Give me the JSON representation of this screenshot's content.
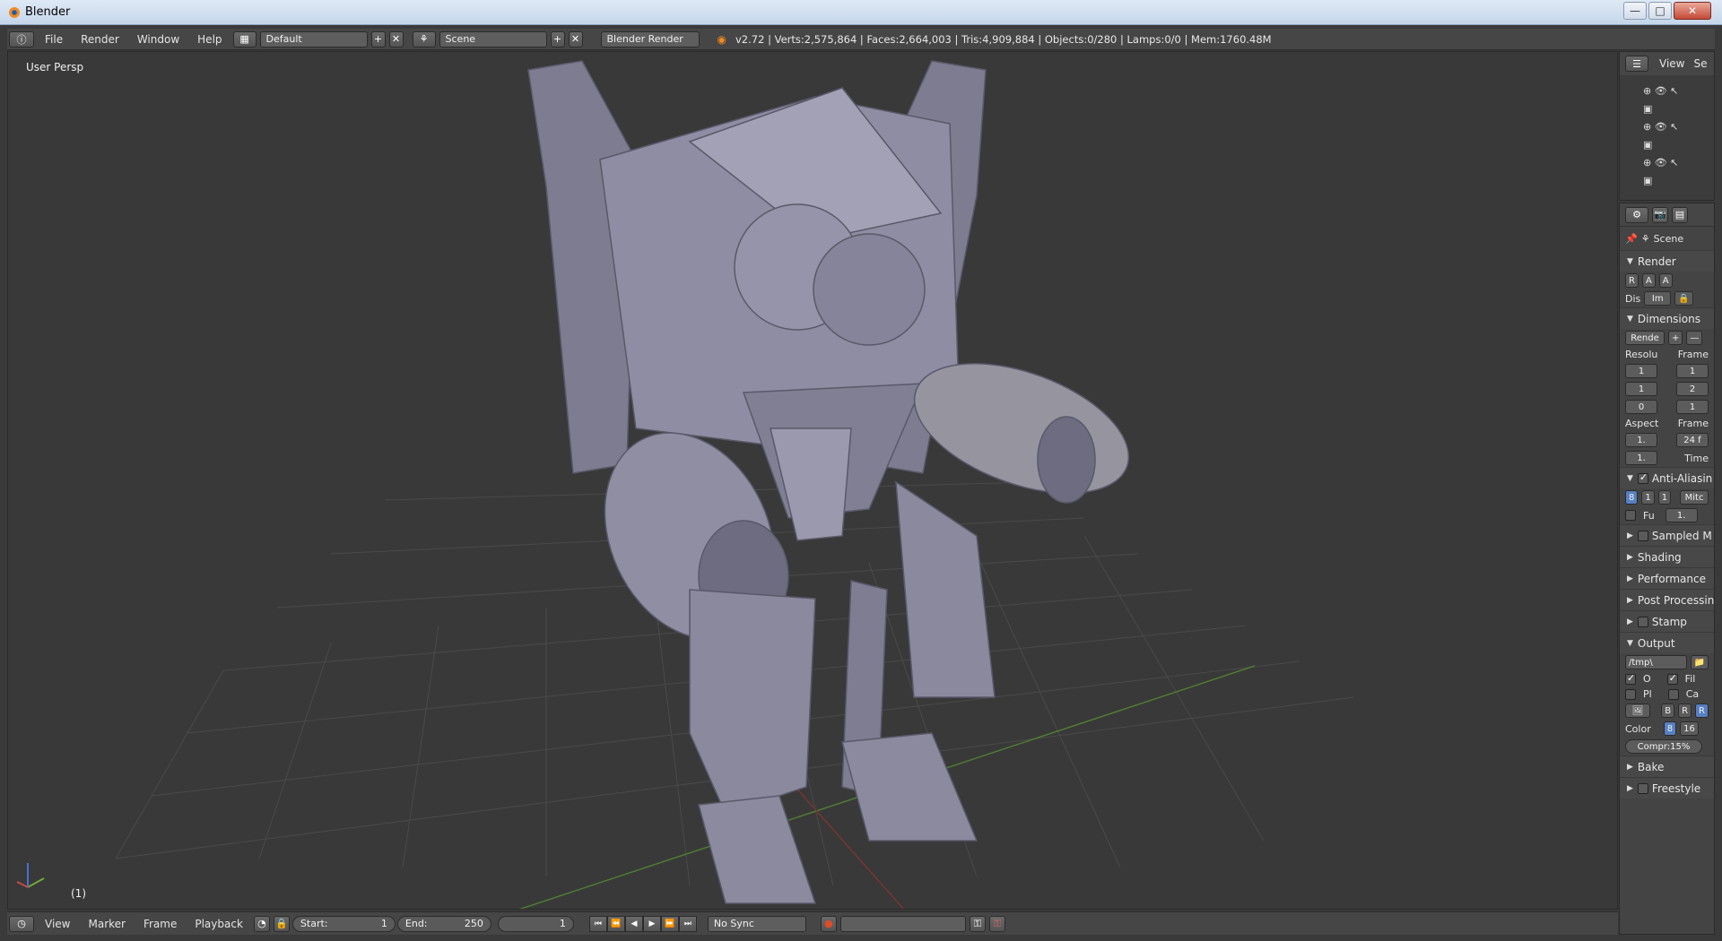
{
  "window": {
    "title": "Blender",
    "controls": [
      "—",
      "□",
      "✕"
    ]
  },
  "info_header": {
    "menus": [
      "File",
      "Render",
      "Window",
      "Help"
    ],
    "layout": "Default",
    "scene": "Scene",
    "engine": "Blender Render",
    "stats": "v2.72 | Verts:2,575,864 | Faces:2,664,003 | Tris:4,909,884 | Objects:0/280 | Lamps:0/0 | Mem:1760.48M"
  },
  "viewport": {
    "view_label": "User Persp",
    "frame_label": "(1)"
  },
  "timeline": {
    "menus": [
      "View",
      "Marker",
      "Frame",
      "Playback"
    ],
    "start_label": "Start:",
    "start_value": "1",
    "end_label": "End:",
    "end_value": "250",
    "current_frame": "1",
    "sync": "No Sync"
  },
  "outliner": {
    "view_menu": "View",
    "search_menu": "Se"
  },
  "properties": {
    "scene_label": "Scene",
    "render_panel": {
      "title": "Render",
      "buttons": [
        "R",
        "A",
        "A"
      ],
      "display_label": "Dis",
      "display_value": "Im"
    },
    "dimensions_panel": {
      "title": "Dimensions",
      "preset": "Rende",
      "resolution_label": "Resolu",
      "frame_label": "Frame",
      "res_values": [
        "1",
        "1",
        "0"
      ],
      "frame_values": [
        "1",
        "2",
        "1"
      ],
      "aspect_label": "Aspect",
      "frame_rate_label": "Frame",
      "aspect_values": [
        "1.",
        "1."
      ],
      "fps": "24 f",
      "time_label": "Time"
    },
    "antialias_panel": {
      "title": "Anti-Aliasin",
      "samples": [
        "8",
        "1",
        "1"
      ],
      "filter": "Mitc",
      "full_label": "Fu",
      "size": "1."
    },
    "collapsed_panels": [
      "Sampled M",
      "Shading",
      "Performance",
      "Post Processin",
      "Stamp"
    ],
    "output_panel": {
      "title": "Output",
      "path": "/tmp\\",
      "opt1": "O",
      "opt2": "Fil",
      "opt3": "Pl",
      "opt4": "Ca",
      "bw": "B",
      "rgb": "R",
      "rgba": "R",
      "color_label": "Color",
      "depth8": "8",
      "depth16": "16",
      "compression": "Compr:15%"
    },
    "bottom_panels": [
      "Bake",
      "Freestyle"
    ]
  }
}
